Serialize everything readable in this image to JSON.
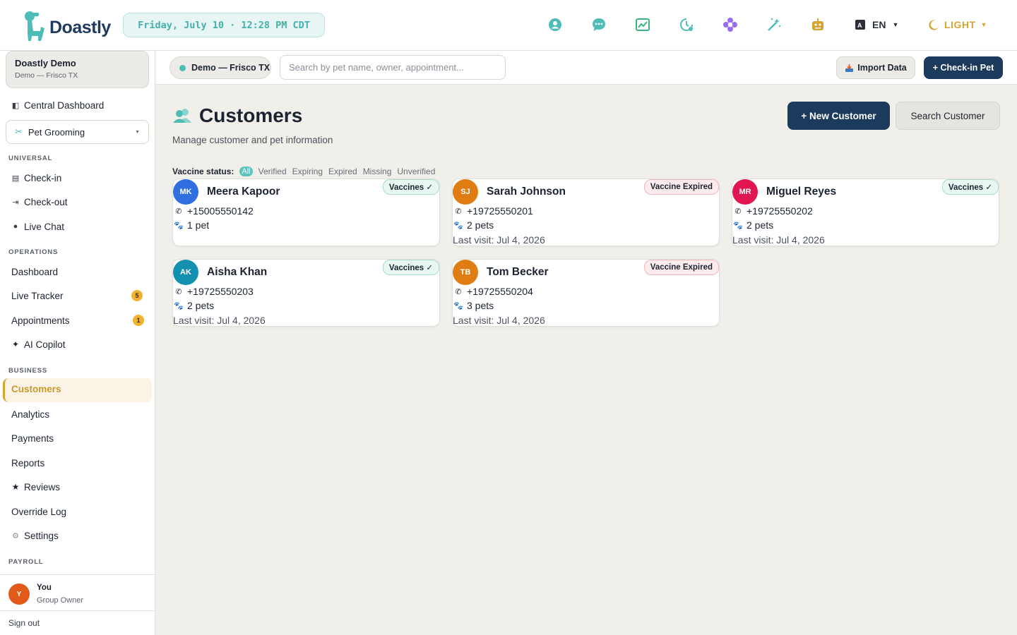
{
  "app": {
    "name": "Doastly",
    "datetime": "Friday, July 10 · 12:28 PM CDT",
    "language": "EN",
    "theme": "LIGHT"
  },
  "colors": {
    "brand_navy": "#1b3a5c",
    "accent_teal": "#4fbdb7",
    "accent_gold": "#d4a533",
    "expired_red": "#f2b6bf"
  },
  "topbar_icons": [
    "support-icon",
    "chat-icon",
    "chart-icon",
    "clock-icon",
    "flower-icon",
    "magic-wand-icon",
    "robot-icon"
  ],
  "sidebar": {
    "org": {
      "name": "Doastly Demo",
      "location": "Demo — Frisco TX"
    },
    "central_dashboard": "Central Dashboard",
    "service_select": "Pet Grooming",
    "sections": {
      "universal": "UNIVERSAL",
      "operations": "OPERATIONS",
      "business": "BUSINESS",
      "payroll": "PAYROLL"
    },
    "universal_items": {
      "checkin": "Check-in",
      "checkout": "Check-out",
      "livechat": "Live Chat"
    },
    "operations_items": {
      "dashboard": "Dashboard",
      "live_tracker": "Live Tracker",
      "live_tracker_count": "5",
      "appointments": "Appointments",
      "appointments_count": "1",
      "ai_copilot": "AI Copilot"
    },
    "business_items": {
      "customers": "Customers",
      "analytics": "Analytics",
      "payments": "Payments",
      "reports": "Reports",
      "reviews": "Reviews",
      "override_log": "Override Log",
      "settings": "Settings"
    },
    "user": {
      "initial": "Y",
      "name": "You",
      "role": "Group Owner"
    },
    "signout": "Sign out"
  },
  "subbar": {
    "location": "Demo — Frisco TX",
    "search_placeholder": "Search by pet name, owner, appointment...",
    "import_label": "Import Data",
    "checkin_label": "+ Check-in Pet"
  },
  "page": {
    "title": "Customers",
    "subtitle": "Manage customer and pet information",
    "new_customer": "+ New Customer",
    "search_customer": "Search Customer",
    "vaccine_filter": {
      "label": "Vaccine status:",
      "options": [
        "All",
        "Verified",
        "Expiring",
        "Expired",
        "Missing",
        "Unverified"
      ],
      "selected": "All"
    }
  },
  "customers": [
    {
      "initials": "MK",
      "name": "Meera Kapoor",
      "phone": "+15005550142",
      "pets": "1 pet",
      "last_visit": "",
      "vaccine": "Vaccines ✓",
      "avatar_color": "#2f6fe0"
    },
    {
      "initials": "SJ",
      "name": "Sarah Johnson",
      "phone": "+19725550201",
      "pets": "2 pets",
      "last_visit": "Last visit: Jul 4, 2026",
      "vaccine": "Vaccine Expired",
      "avatar_color": "#e07d12"
    },
    {
      "initials": "MR",
      "name": "Miguel Reyes",
      "phone": "+19725550202",
      "pets": "2 pets",
      "last_visit": "Last visit: Jul 4, 2026",
      "vaccine": "Vaccines ✓",
      "avatar_color": "#e0184f"
    },
    {
      "initials": "AK",
      "name": "Aisha Khan",
      "phone": "+19725550203",
      "pets": "2 pets",
      "last_visit": "Last visit: Jul 4, 2026",
      "vaccine": "Vaccines ✓",
      "avatar_color": "#138fb0"
    },
    {
      "initials": "TB",
      "name": "Tom Becker",
      "phone": "+19725550204",
      "pets": "3 pets",
      "last_visit": "Last visit: Jul 4, 2026",
      "vaccine": "Vaccine Expired",
      "avatar_color": "#e07d12"
    }
  ]
}
